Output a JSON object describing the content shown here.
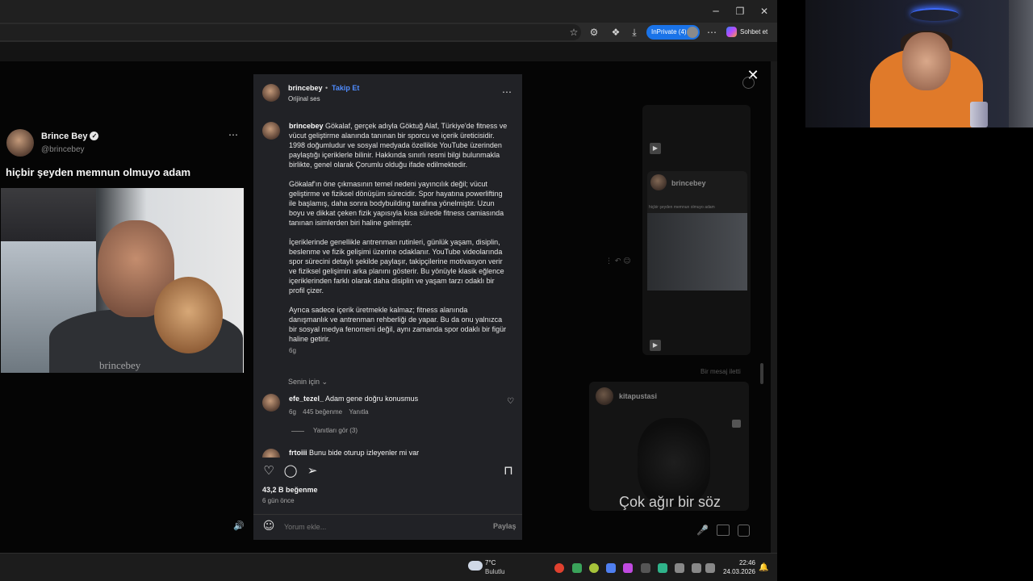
{
  "browser": {
    "inprivate_label": "InPrivate (4)",
    "chat_label": "Sohbet et"
  },
  "post": {
    "author_name": "Brince Bey",
    "author_handle": "@brincebey",
    "text": "hiçbir şeyden memnun olmuyo adam",
    "watermark": "brincebey"
  },
  "reel": {
    "username": "brincebey",
    "separator": "•",
    "follow_label": "Takip Et",
    "audio": "Orijinal ses",
    "caption_user": "brincebey",
    "caption_p1": "Gökalaf, gerçek adıyla Göktuğ Alaf, Türkiye'de fitness ve vücut geliştirme alanında tanınan bir sporcu ve içerik üreticisidir. 1998 doğumludur ve sosyal medyada özellikle YouTube üzerinden paylaştığı içeriklerle bilinir. Hakkında sınırlı resmi bilgi bulunmakla birlikte, genel olarak Çorumlu olduğu ifade edilmektedir.",
    "caption_p2": "Gökalaf'ın öne çıkmasının temel nedeni yayıncılık değil; vücut geliştirme ve fiziksel dönüşüm sürecidir. Spor hayatına powerlifting ile başlamış, daha sonra bodybuilding tarafına yönelmiştir. Uzun boyu ve dikkat çeken fizik yapısıyla kısa sürede fitness camiasında tanınan isimlerden biri haline gelmiştir.",
    "caption_p3": "İçeriklerinde genellikle antrenman rutinleri, günlük yaşam, disiplin, beslenme ve fizik gelişimi üzerine odaklanır. YouTube videolarında spor sürecini detaylı şekilde paylaşır, takipçilerine motivasyon verir ve fiziksel gelişimin arka planını gösterir. Bu yönüyle klasik eğlence içeriklerinden farklı olarak daha disiplin ve yaşam tarzı odaklı bir profil çizer.",
    "caption_p4": "Ayrıca sadece içerik üretmekle kalmaz; fitness alanında danışmanlık ve antrenman rehberliği de yapar. Bu da onu yalnızca bir sosyal medya fenomeni değil, aynı zamanda spor odaklı bir figür haline getirir.",
    "caption_time": "6g",
    "sort_label": "Senin için",
    "comments": [
      {
        "user": "efe_tezel_",
        "text": "Adam gene doğru konusmus",
        "time": "6g",
        "likes": "445 beğenme",
        "reply": "Yanıtla",
        "view_replies": "Yanıtları gör (3)"
      },
      {
        "user": "frtoiii",
        "text": "Bunu bide oturup izleyenler mi var"
      }
    ],
    "likes_count": "43,2 B beğenme",
    "posted": "6 gün önce",
    "comment_placeholder": "Yorum ekle...",
    "share_label": "Paylaş"
  },
  "dm": {
    "card1_name": "brincebey",
    "card1_text": "hiçbir şeyden memnun olmuyo adam",
    "status": "Bir mesaj iletti",
    "card2_name": "kitapustasi",
    "subtitle": "Çok ağır bir söz"
  },
  "taskbar": {
    "temp": "7°C",
    "weather": "Bulutlu",
    "time": "22:46",
    "date": "24.03.2026"
  }
}
